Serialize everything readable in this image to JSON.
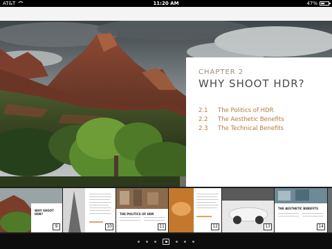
{
  "status_bar": {
    "carrier": "AT&T",
    "time": "11:20 AM",
    "battery_percent_label": "47%",
    "battery_level": 0.47,
    "wifi_icon": "wifi-icon",
    "battery_icon": "battery-icon"
  },
  "chapter": {
    "label": "CHAPTER 2",
    "title": "WHY SHOOT HDR?",
    "toc": [
      {
        "number": "2.1",
        "title": "The Politics of HDR"
      },
      {
        "number": "2.2",
        "title": "The Aesthetic Benefits"
      },
      {
        "number": "2.3",
        "title": "The Technical Benefits"
      }
    ]
  },
  "thumbnails": [
    {
      "page": "9",
      "caption": "WHY SHOOT HDR?"
    },
    {
      "page": "10",
      "caption": ""
    },
    {
      "page": "11",
      "caption": "THE POLITICS OF HDR"
    },
    {
      "page": "12",
      "caption": ""
    },
    {
      "page": "13",
      "caption": "THE AESTHETIC BENEFITS"
    },
    {
      "page": "14",
      "caption": "THE AESTHETIC BENEFITS"
    }
  ],
  "page_indicator": {
    "count": 7,
    "active_index": 3
  },
  "colors": {
    "toc_accent": "#b47a3e",
    "chapter_label": "#9a8c7d",
    "title_text": "#4a4a4a"
  }
}
